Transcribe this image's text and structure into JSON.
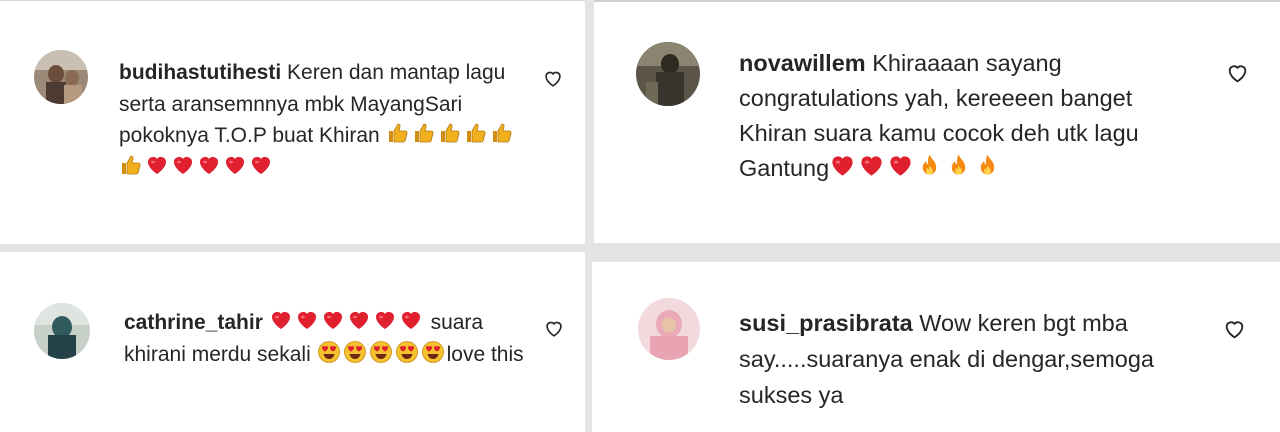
{
  "comments": [
    {
      "username": "budihastutihesti",
      "segments": [
        {
          "t": "text",
          "v": " Keren dan mantap lagu serta aransemnnya mbk MayangSari pokoknya T.O.P buat Khiran "
        },
        {
          "t": "emoji",
          "v": "thumbs-up-icon",
          "n": 6
        },
        {
          "t": "emoji",
          "v": "heart-icon",
          "n": 5
        }
      ]
    },
    {
      "username": "novawillem",
      "segments": [
        {
          "t": "text",
          "v": " Khiraaaan sayang congratulations yah, kereeeen banget Khiran suara kamu cocok deh utk lagu Gantung"
        },
        {
          "t": "emoji",
          "v": "heart-icon",
          "n": 3
        },
        {
          "t": "emoji",
          "v": "fire-icon",
          "n": 3
        }
      ]
    },
    {
      "username": "cathrine_tahir",
      "segments": [
        {
          "t": "text",
          "v": " "
        },
        {
          "t": "emoji",
          "v": "heart-icon",
          "n": 6
        },
        {
          "t": "text",
          "v": " suara khirani merdu sekali "
        },
        {
          "t": "emoji",
          "v": "heart-eyes-icon",
          "n": 5
        },
        {
          "t": "text",
          "v": "love this"
        }
      ]
    },
    {
      "username": "susi_prasibrata",
      "segments": [
        {
          "t": "text",
          "v": " Wow keren bgt mba say.....suaranya enak di dengar,semoga sukses ya"
        }
      ]
    }
  ],
  "colors": {
    "username": "#262626",
    "text": "#262626",
    "heart": "#e0202e",
    "thumb": "#f2b01e",
    "fire": "#f58a12",
    "face": "#f6c12f"
  }
}
